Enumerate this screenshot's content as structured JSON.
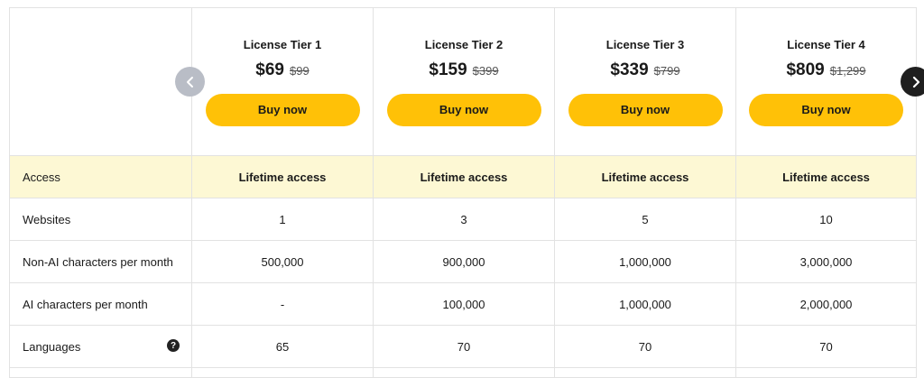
{
  "tiers": [
    {
      "name": "License Tier 1",
      "price": "$69",
      "old_price": "$99",
      "button": "Buy now"
    },
    {
      "name": "License Tier 2",
      "price": "$159",
      "old_price": "$399",
      "button": "Buy now"
    },
    {
      "name": "License Tier 3",
      "price": "$339",
      "old_price": "$799",
      "button": "Buy now"
    },
    {
      "name": "License Tier 4",
      "price": "$809",
      "old_price": "$1,299",
      "button": "Buy now"
    }
  ],
  "access": {
    "label": "Access",
    "values": [
      "Lifetime access",
      "Lifetime access",
      "Lifetime access",
      "Lifetime access"
    ]
  },
  "rows": [
    {
      "label": "Websites",
      "values": [
        "1",
        "3",
        "5",
        "10"
      ]
    },
    {
      "label": "Non-AI characters per month",
      "values": [
        "500,000",
        "900,000",
        "1,000,000",
        "3,000,000"
      ]
    },
    {
      "label": "AI characters per month",
      "values": [
        "-",
        "100,000",
        "1,000,000",
        "2,000,000"
      ]
    },
    {
      "label": "Languages",
      "values": [
        "65",
        "70",
        "70",
        "70"
      ]
    }
  ],
  "icons": {
    "prev": "chevron-left-icon",
    "next": "chevron-right-icon",
    "help": "question-circle-icon"
  },
  "colors": {
    "button": "#ffc107",
    "highlight_row": "#fdf8d4",
    "nav_prev": "#b9bdc6",
    "nav_next": "#1f1f1f"
  }
}
